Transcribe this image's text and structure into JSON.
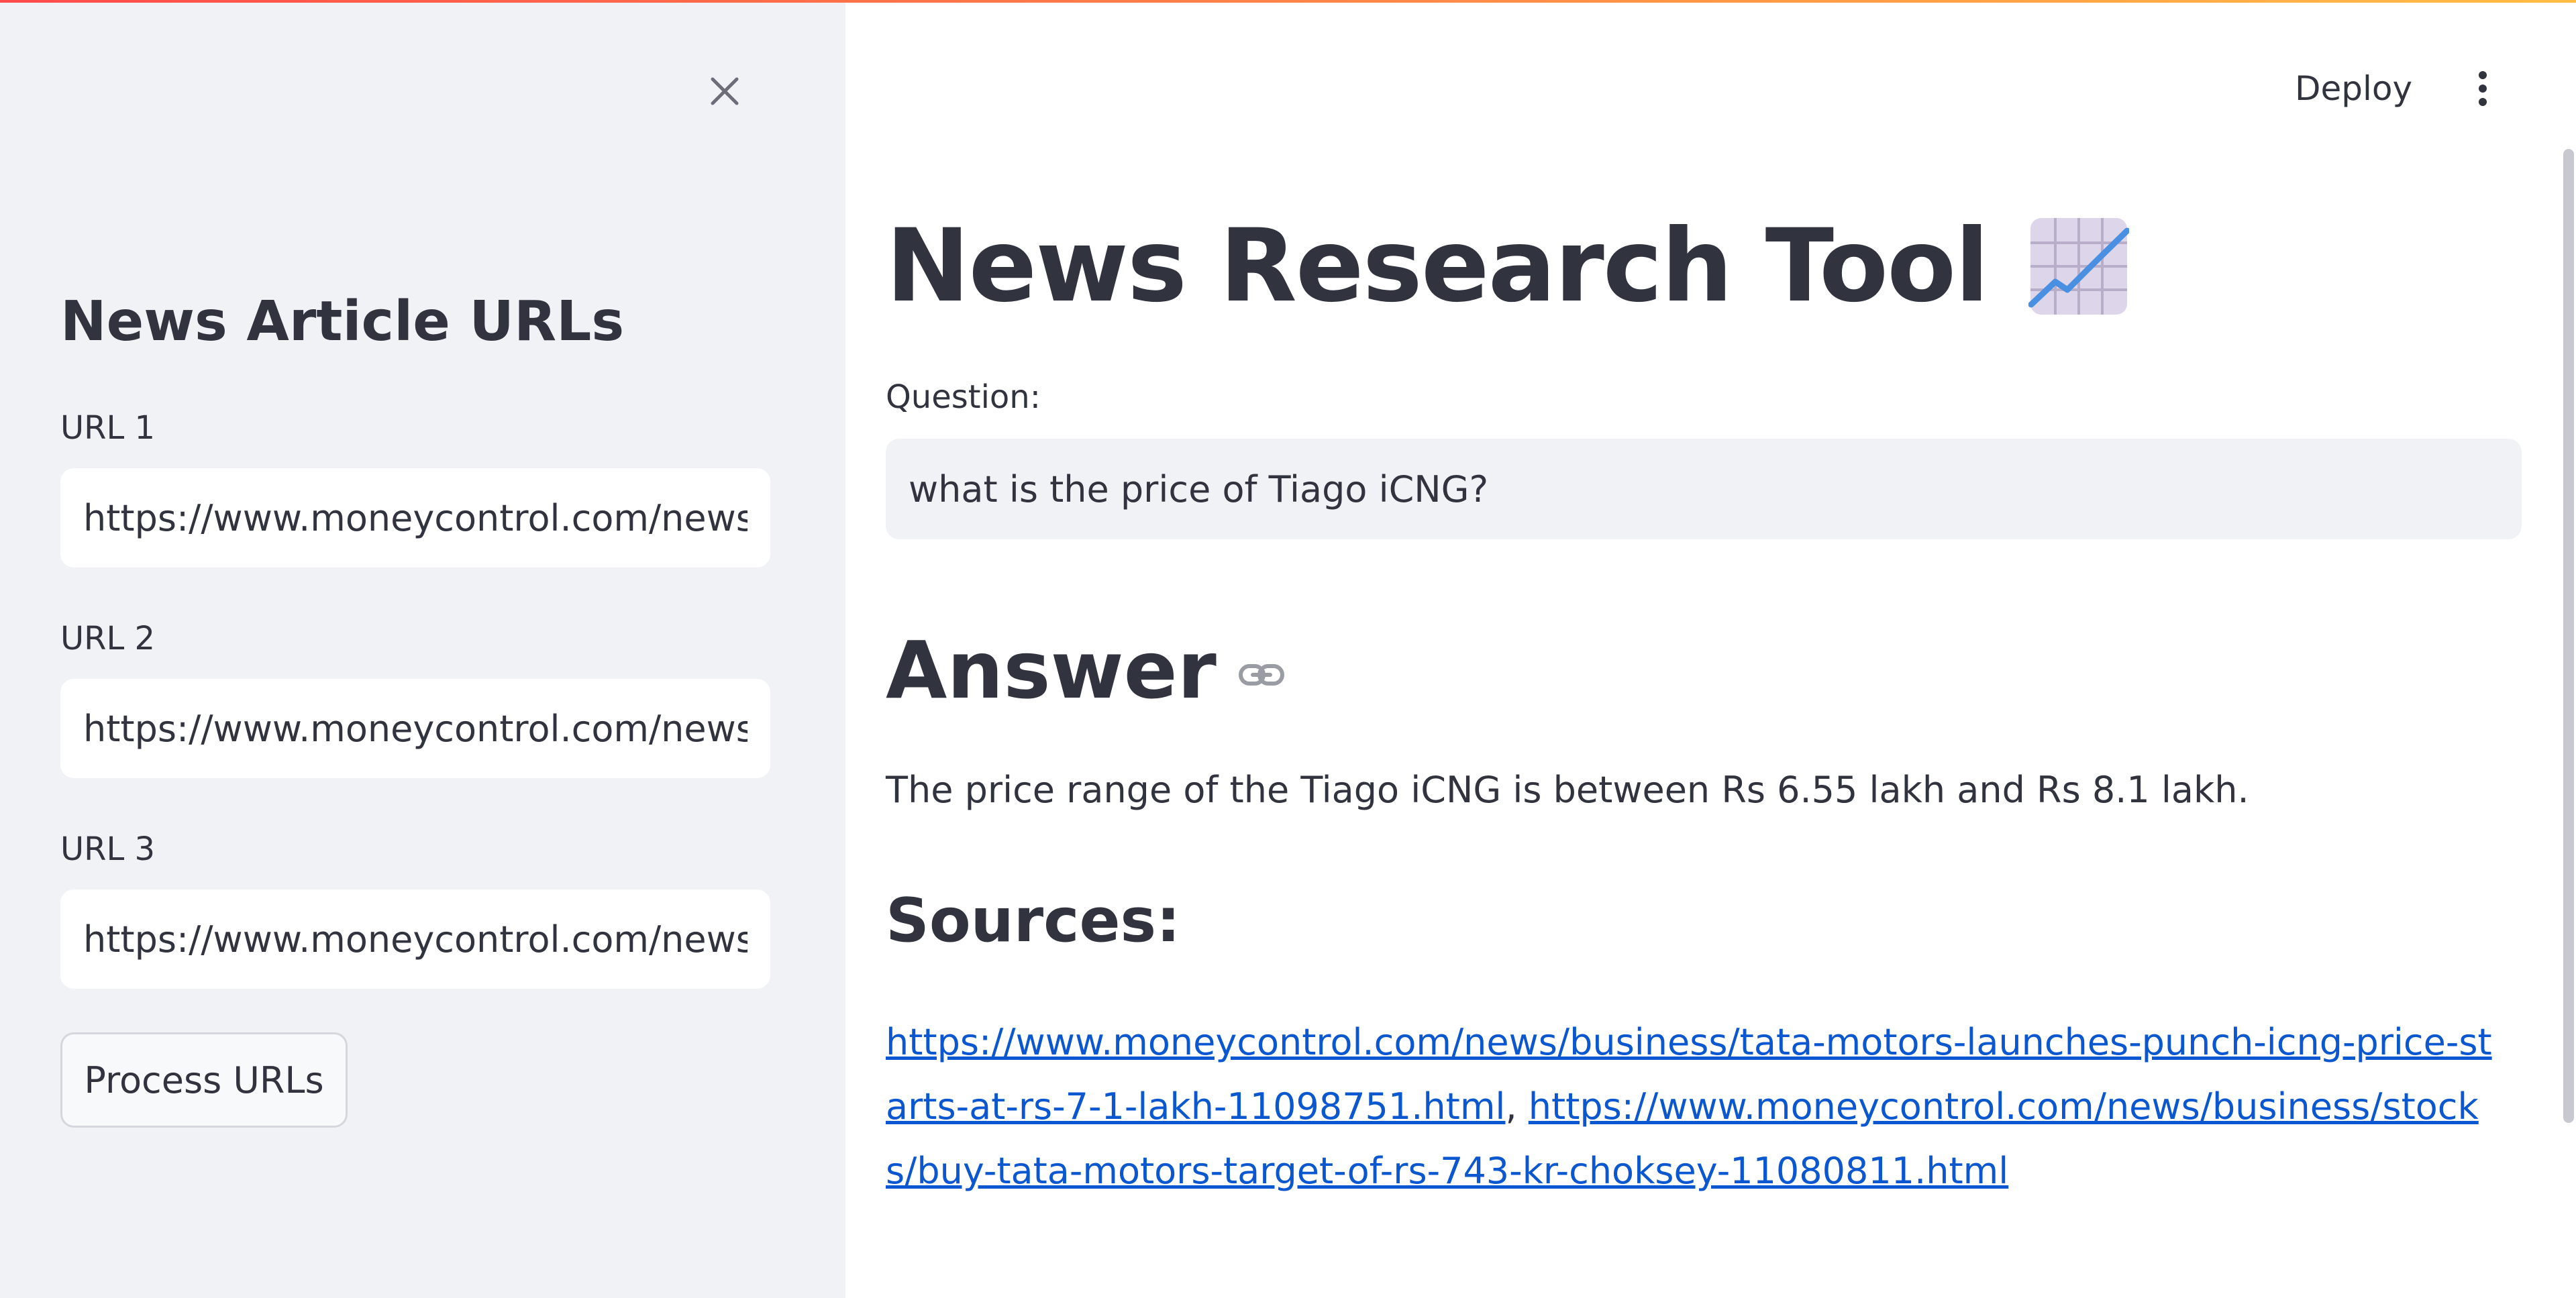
{
  "sidebar": {
    "title": "News Article URLs",
    "urls": [
      {
        "label": "URL 1",
        "value": "https://www.moneycontrol.com/news/b"
      },
      {
        "label": "URL 2",
        "value": "https://www.moneycontrol.com/news/b"
      },
      {
        "label": "URL 3",
        "value": "https://www.moneycontrol.com/news/b"
      }
    ],
    "process_button": "Process URLs",
    "close_icon": "close-icon"
  },
  "header": {
    "deploy_label": "Deploy",
    "menu_icon": "vertical-dots-icon"
  },
  "main": {
    "title": "News Research Tool",
    "title_icon": "chart-increasing-icon",
    "question_label": "Question:",
    "question_value": "what is the price of Tiago iCNG?",
    "answer_heading": "Answer",
    "answer_text": "The price range of the Tiago iCNG is between Rs 6.55 lakh and Rs 8.1 lakh.",
    "sources_heading": "Sources:",
    "sources": [
      "https://www.moneycontrol.com/news/business/tata-motors-launches-punch-icng-price-starts-at-rs-7-1-lakh-11098751.html",
      "https://www.moneycontrol.com/news/business/stocks/buy-tata-motors-target-of-rs-743-kr-choksey-11080811.html"
    ],
    "sources_separator": ", "
  },
  "colors": {
    "sidebar_bg": "#f0f2f6",
    "text": "#31333f",
    "link": "#0b57d0",
    "top_gradient_start": "#ff4b4b",
    "top_gradient_end": "#ffbd45"
  }
}
